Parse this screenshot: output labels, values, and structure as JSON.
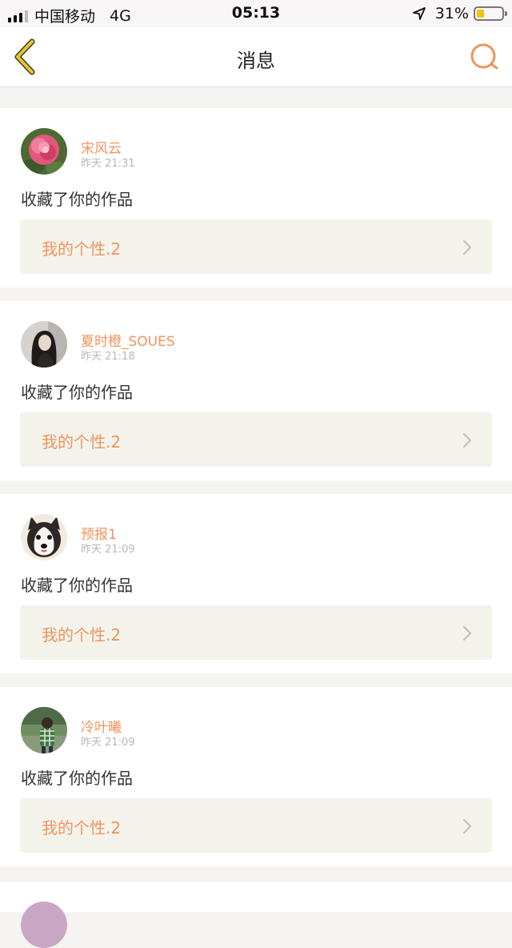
{
  "status_bar": {
    "carrier": "中国移动",
    "network": "4G",
    "time": "05:13",
    "battery": "31%",
    "battery_level": 0.31,
    "icons": [
      "signal-icon",
      "location-arrow-icon",
      "battery-icon"
    ]
  },
  "header": {
    "title": "消息",
    "back_icon": "chevron-left-icon",
    "search_icon": "search-icon",
    "accent": "#f0945c"
  },
  "messages": [
    {
      "username": "宋风云",
      "time": "昨天 21:31",
      "action": "收藏了你的作品",
      "work": "我的个性.2",
      "avatar": "peony-flower-photo"
    },
    {
      "username": "夏时橙_SOUES",
      "time": "昨天 21:18",
      "action": "收藏了你的作品",
      "work": "我的个性.2",
      "avatar": "girl-portrait-photo"
    },
    {
      "username": "预报1",
      "time": "昨天 21:09",
      "action": "收藏了你的作品",
      "work": "我的个性.2",
      "avatar": "husky-dog-photo"
    },
    {
      "username": "冷叶曦",
      "time": "昨天 21:09",
      "action": "收藏了你的作品",
      "work": "我的个性.2",
      "avatar": "child-outdoor-photo"
    }
  ],
  "colors": {
    "accent_orange": "#f0945c",
    "back_icon_yellow": "#e8c62b",
    "page_background": "#f6f4f3",
    "work_card_background": "#f3f3ec"
  }
}
